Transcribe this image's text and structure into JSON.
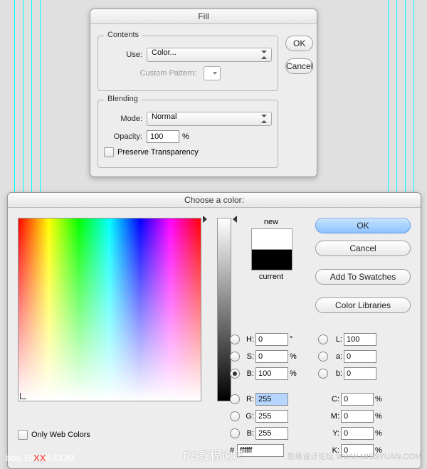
{
  "guides": [
    20,
    32,
    44,
    56,
    545,
    557,
    569,
    581
  ],
  "fill": {
    "title": "Fill",
    "contents_group": "Contents",
    "use_label": "Use:",
    "use_value": "Color...",
    "custom_pattern_label": "Custom Pattern:",
    "blending_group": "Blending",
    "mode_label": "Mode:",
    "mode_value": "Normal",
    "opacity_label": "Opacity:",
    "opacity_value": "100",
    "opacity_unit": "%",
    "preserve_label": "Preserve Transparency",
    "ok": "OK",
    "cancel": "Cancel"
  },
  "picker": {
    "title": "Choose a color:",
    "ok": "OK",
    "cancel": "Cancel",
    "add_swatches": "Add To Swatches",
    "color_libraries": "Color Libraries",
    "new_label": "new",
    "current_label": "current",
    "new_color": "#ffffff",
    "current_color": "#000000",
    "only_web": "Only Web Colors",
    "fields": {
      "H": {
        "value": "0",
        "unit": "°",
        "selected": false
      },
      "S": {
        "value": "0",
        "unit": "%",
        "selected": false
      },
      "B": {
        "value": "100",
        "unit": "%",
        "selected": true
      },
      "R": {
        "value": "255",
        "unit": "",
        "selected": false
      },
      "G": {
        "value": "255",
        "unit": "",
        "selected": false
      },
      "B2": {
        "value": "255",
        "unit": "",
        "selected": false
      },
      "L": {
        "value": "100",
        "unit": "",
        "selected": false
      },
      "a": {
        "value": "0",
        "unit": "",
        "selected": false
      },
      "b": {
        "value": "0",
        "unit": "",
        "selected": false
      },
      "C": {
        "value": "0",
        "unit": "%"
      },
      "M": {
        "value": "0",
        "unit": "%"
      },
      "Y": {
        "value": "0",
        "unit": "%"
      },
      "K": {
        "value": "0",
        "unit": "%"
      }
    },
    "hex": "ffffff"
  },
  "watermark": {
    "main": "PS教程论坛",
    "left_pre": "bbs.16",
    "left_mid": "XX",
    "left_post": "8.COM",
    "right": "思缘设计论坛 WWW.MISSYUAN.COM"
  }
}
